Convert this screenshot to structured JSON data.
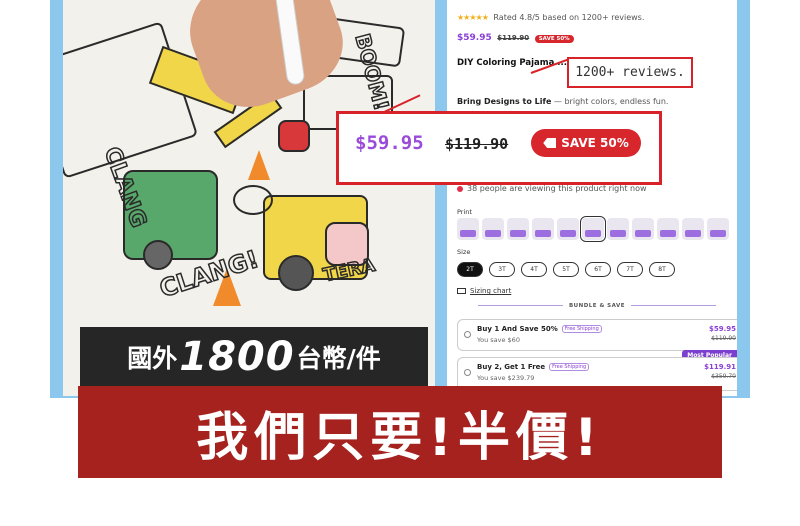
{
  "product": {
    "rating_text": "Rated 4.8/5 based on 1200+ reviews.",
    "stars": "★★★★★",
    "price": "$59.95",
    "compare_price": "$119.90",
    "save_badge": "SAVE 50%",
    "title": "DIY Coloring Pajama ... for themselves!",
    "tagline_strong": "Bring Designs to Life",
    "tagline_rest": " — bright colors, endless fun.",
    "viewers_text": "38 people are viewing this product right now",
    "print_label": "Print",
    "size_label": "Size",
    "sizes": [
      "2T",
      "3T",
      "4T",
      "5T",
      "6T",
      "7T",
      "8T"
    ],
    "sizing_chart": "Sizing chart",
    "bundle_heading": "BUNDLE & SAVE",
    "bundles": [
      {
        "name": "Buy 1 And Save 50%",
        "shipping": "Free Shipping",
        "you_save": "You save $60",
        "price": "$59.95",
        "compare": "$119.90"
      },
      {
        "name": "Buy 2, Get 1 Free",
        "shipping": "Free Shipping",
        "you_save": "You save $239.79",
        "price": "$119.91",
        "compare": "$359.70"
      }
    ],
    "most_popular": "Most Popular"
  },
  "callouts": {
    "reviews": "1200+ reviews.",
    "price": "$59.95",
    "compare_price": "$119.90",
    "save_badge": "SAVE 50%"
  },
  "banner": {
    "line1_prefix": "國外",
    "line1_number": "1800",
    "line1_suffix": "台幣/件",
    "line2": "我們只要!半價!"
  },
  "colors": {
    "frame_blue": "#8cc8ee",
    "accent_purple": "#8a3fd6",
    "sale_red": "#d8262d",
    "banner_red": "#a6221f",
    "banner_dark": "#262626"
  }
}
